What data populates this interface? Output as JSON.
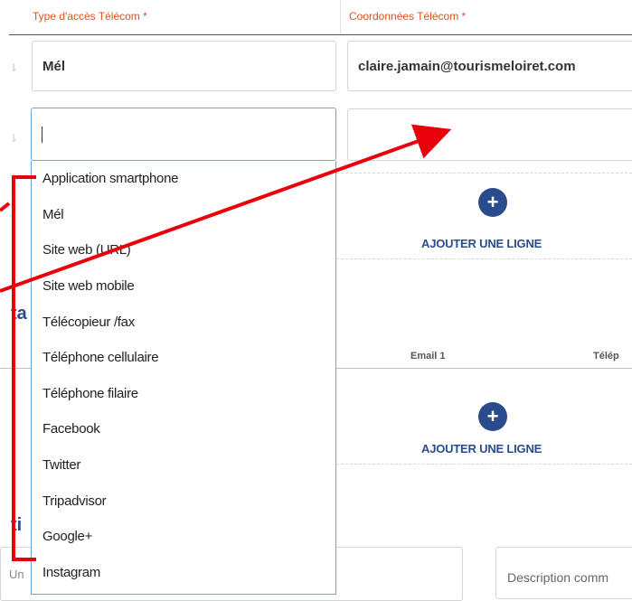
{
  "columns": {
    "type_label": "Type d'accès Télécom *",
    "coords_label": "Coordonnées Télécom *"
  },
  "rows": [
    {
      "type": "Mél",
      "coords": "claire.jamain@tourismeloiret.com"
    },
    {
      "type": "",
      "coords": ""
    }
  ],
  "add_line_label": "AJOUTER UNE LIGNE",
  "add_icon": "plus-icon",
  "contacts_table": {
    "email_col": "Email 1",
    "phone_col": "Télép"
  },
  "section_letters": [
    "ta",
    "ti"
  ],
  "left_cut_label": "Un",
  "description_placeholder": "Description comm",
  "dropdown_options": [
    "Application smartphone",
    "Mél",
    "Site web (URL)",
    "Site web mobile",
    "Télécopieur /fax",
    "Téléphone cellulaire",
    "Téléphone filaire",
    "Facebook",
    "Twitter",
    "Tripadvisor",
    "Google+",
    "Instagram"
  ],
  "annotation_color": "#e8000b",
  "accent_color": "#2b4c8c",
  "required_color": "#d9531e"
}
